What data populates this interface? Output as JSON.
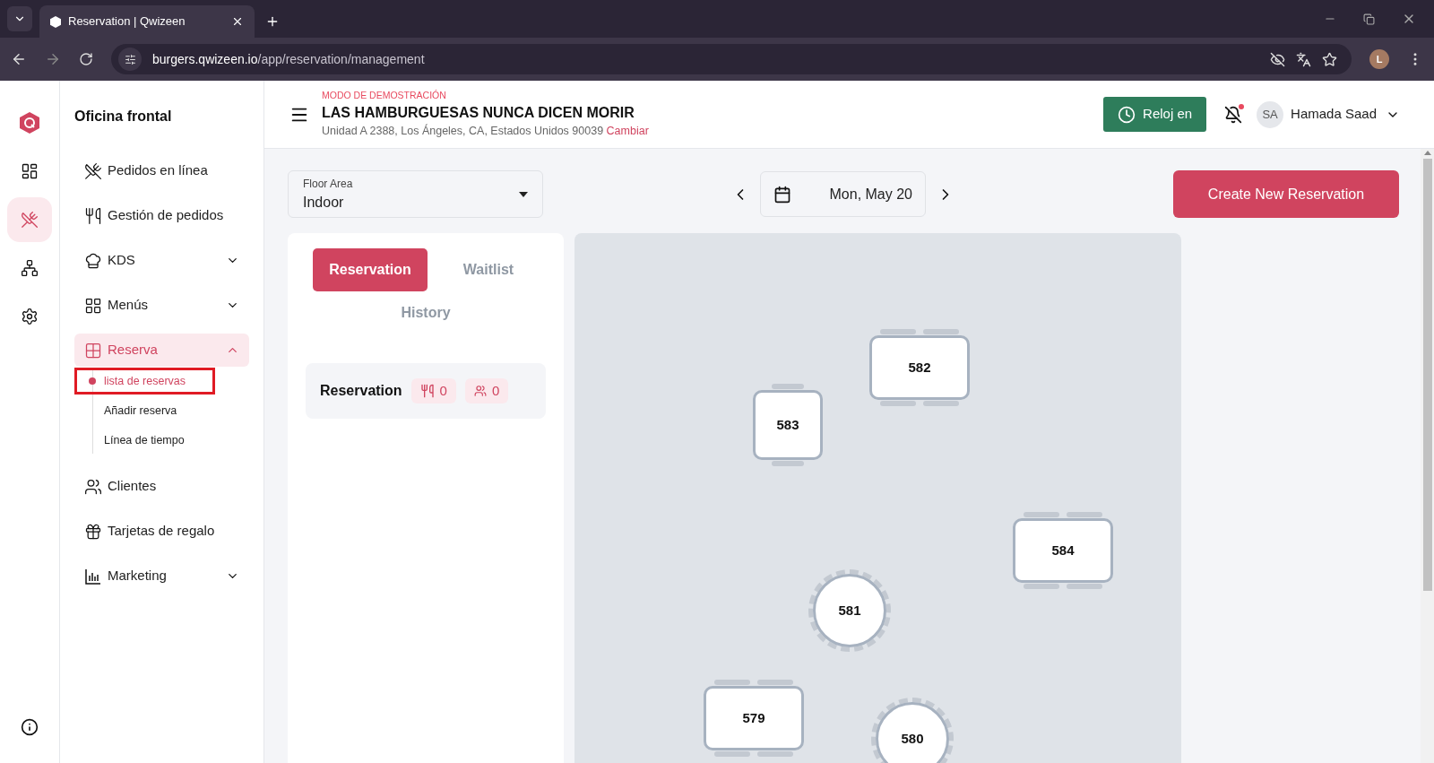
{
  "browser": {
    "tab_title": "Reservation | Qwizeen",
    "url_host": "burgers.qwizeen.io",
    "url_path": "/app/reservation/management",
    "profile_initial": "L"
  },
  "rail": [
    {
      "kind": "logo",
      "selected": false
    },
    {
      "kind": "dashboard",
      "selected": false
    },
    {
      "kind": "front",
      "selected": true
    },
    {
      "kind": "org",
      "selected": false
    },
    {
      "kind": "settings",
      "selected": false
    }
  ],
  "sidebar": {
    "title": "Oficina frontal",
    "items": [
      {
        "label": "Pedidos en línea",
        "selected": false
      },
      {
        "label": "Gestión de pedidos",
        "selected": false
      },
      {
        "label": "KDS",
        "selected": false,
        "expanded": false
      },
      {
        "label": "Menús",
        "selected": false,
        "expanded": false
      },
      {
        "label": "Reserva",
        "selected": true,
        "expanded": true,
        "children": [
          {
            "label": "lista de reservas",
            "selected": true,
            "highlighted": true
          },
          {
            "label": "Añadir reserva",
            "selected": false,
            "highlighted": false
          },
          {
            "label": "Línea de tiempo",
            "selected": false,
            "highlighted": false
          }
        ]
      },
      {
        "label": "Clientes",
        "selected": false
      },
      {
        "label": "Tarjetas de regalo",
        "selected": false
      },
      {
        "label": "Marketing",
        "selected": false,
        "expanded": false
      }
    ]
  },
  "header": {
    "demo_label": "MODO DE DEMOSTRACIÓN",
    "restaurant_name": "LAS HAMBURGUESAS NUNCA DICEN MORIR",
    "address": "Unidad A 2388, Los Ángeles, CA, Estados Unidos 90039",
    "change_link": "Cambiar",
    "clock_button": "Reloj en",
    "user_initials": "SA",
    "user_name": "Hamada Saad"
  },
  "floor_select": {
    "label": "Floor Area",
    "value": "Indoor"
  },
  "date": "Mon, May 20",
  "create_button": "Create New Reservation",
  "tabs": [
    {
      "label": "Reservation",
      "selected": true
    },
    {
      "label": "Waitlist",
      "selected": false
    },
    {
      "label": "History",
      "selected": false
    }
  ],
  "summary": {
    "title": "Reservation",
    "covers": "0",
    "guests": "0"
  },
  "tables": [
    {
      "number": "582",
      "kind": "rect"
    },
    {
      "number": "583",
      "kind": "square"
    },
    {
      "number": "584",
      "kind": "rect"
    },
    {
      "number": "581",
      "kind": "round"
    },
    {
      "number": "579",
      "kind": "rect"
    },
    {
      "number": "580",
      "kind": "round"
    }
  ]
}
